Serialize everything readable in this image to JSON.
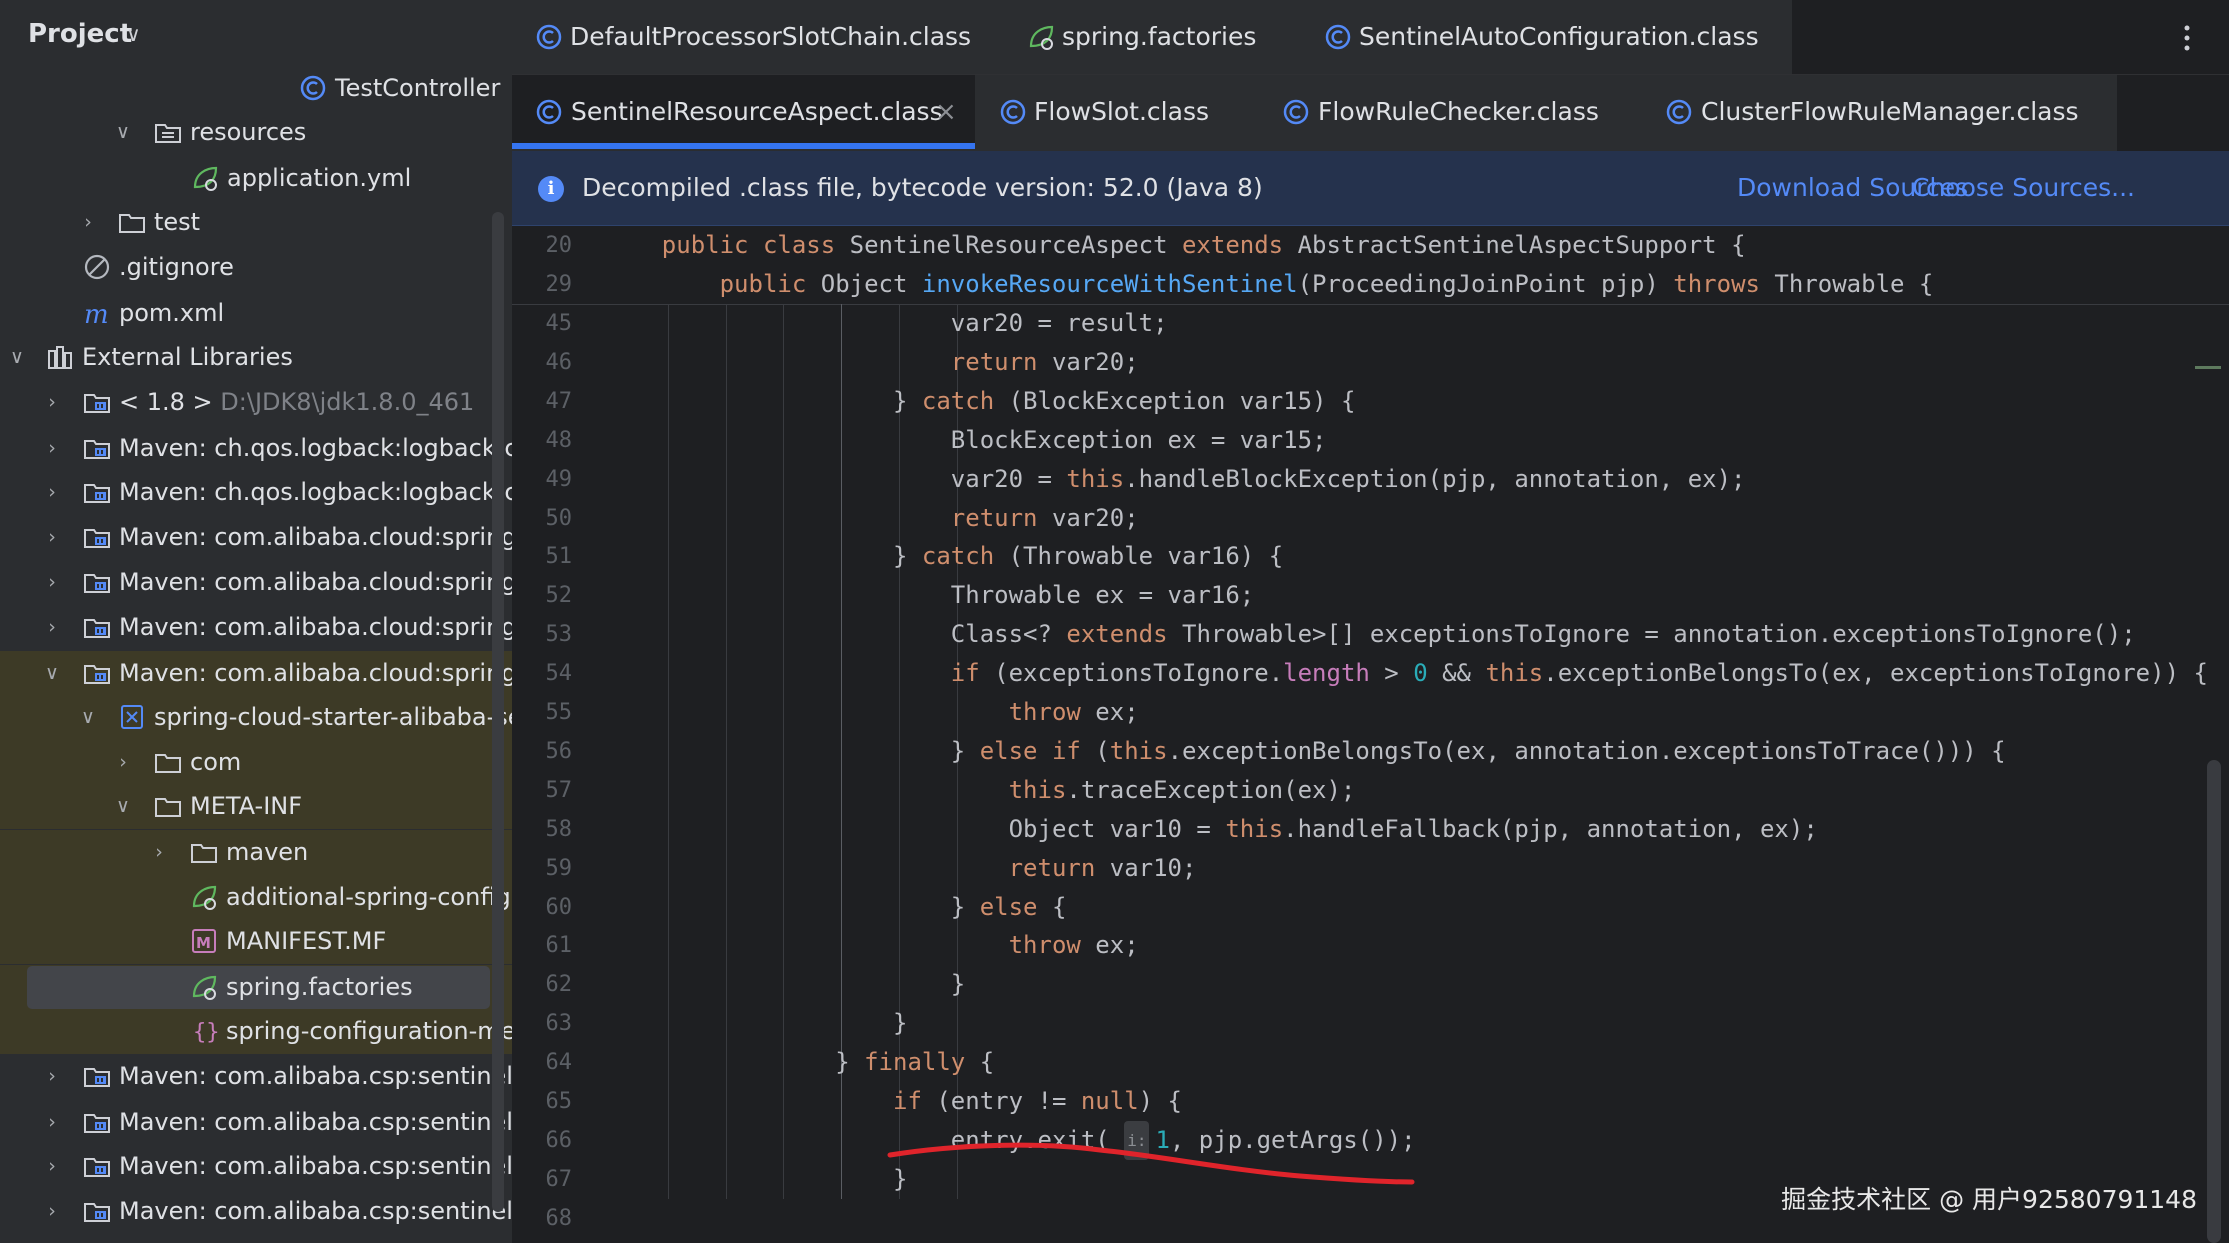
{
  "project": {
    "title": "Project",
    "tree": [
      {
        "label": "TestController",
        "icon": "class-icon",
        "expanded": null
      },
      {
        "label": "resources",
        "icon": "resources-folder-icon",
        "expanded": true
      },
      {
        "label": "application.yml",
        "icon": "spring-config-icon",
        "expanded": null
      },
      {
        "label": "test",
        "icon": "folder-icon",
        "expanded": false
      },
      {
        "label": ".gitignore",
        "icon": "gitignore-icon",
        "expanded": null
      },
      {
        "label": "pom.xml",
        "icon": "maven-icon",
        "expanded": null
      },
      {
        "label": "External Libraries",
        "icon": "libraries-icon",
        "expanded": true
      },
      {
        "label": "< 1.8 >",
        "path": "D:\\JDK8\\jdk1.8.0_461",
        "icon": "jdk-icon",
        "expanded": false
      },
      {
        "label": "Maven: ch.qos.logback:logback-cl",
        "icon": "library-icon",
        "expanded": false
      },
      {
        "label": "Maven: ch.qos.logback:logback-co",
        "icon": "library-icon",
        "expanded": false
      },
      {
        "label": "Maven: com.alibaba.cloud:spring-c",
        "icon": "library-icon",
        "expanded": false
      },
      {
        "label": "Maven: com.alibaba.cloud:spring-c",
        "icon": "library-icon",
        "expanded": false
      },
      {
        "label": "Maven: com.alibaba.cloud:spring-c",
        "icon": "library-icon",
        "expanded": false
      },
      {
        "label": "Maven: com.alibaba.cloud:spring-c",
        "icon": "library-icon",
        "expanded": true
      },
      {
        "label": "spring-cloud-starter-alibaba-se",
        "icon": "jar-icon",
        "expanded": true
      },
      {
        "label": "com",
        "icon": "folder-icon",
        "expanded": false
      },
      {
        "label": "META-INF",
        "icon": "folder-icon",
        "expanded": true
      },
      {
        "label": "maven",
        "icon": "folder-icon",
        "expanded": false
      },
      {
        "label": "additional-spring-configu",
        "icon": "spring-config-icon",
        "expanded": null
      },
      {
        "label": "MANIFEST.MF",
        "icon": "manifest-icon",
        "expanded": null
      },
      {
        "label": "spring.factories",
        "icon": "spring-factories-icon",
        "expanded": null
      },
      {
        "label": "spring-configuration-met",
        "icon": "json-icon",
        "expanded": null
      },
      {
        "label": "Maven: com.alibaba.csp:sentinel-a",
        "icon": "library-icon",
        "expanded": false
      },
      {
        "label": "Maven: com.alibaba.csp:sentinel-c",
        "icon": "library-icon",
        "expanded": false
      },
      {
        "label": "Maven: com.alibaba.csp:sentinel-c",
        "icon": "library-icon",
        "expanded": false
      },
      {
        "label": "Maven: com.alibaba.csp:sentinel-c",
        "icon": "library-icon",
        "expanded": false
      }
    ]
  },
  "tabs": {
    "row1": [
      {
        "label": "DefaultProcessorSlotChain.class",
        "icon": "class-icon"
      },
      {
        "label": "spring.factories",
        "icon": "spring-factories-icon"
      },
      {
        "label": "SentinelAutoConfiguration.class",
        "icon": "class-icon"
      }
    ],
    "row2": [
      {
        "label": "SentinelResourceAspect.class",
        "icon": "class-icon",
        "active": true
      },
      {
        "label": "FlowSlot.class",
        "icon": "class-icon"
      },
      {
        "label": "FlowRuleChecker.class",
        "icon": "class-icon"
      },
      {
        "label": "ClusterFlowRuleManager.class",
        "icon": "class-icon"
      }
    ]
  },
  "banner": {
    "text": "Decompiled .class file, bytecode version: 52.0 (Java 8)",
    "download": "Download Sources",
    "choose": "Choose Sources..."
  },
  "code": {
    "sticky": [
      {
        "num": "20",
        "text": "public class SentinelResourceAspect extends AbstractSentinelAspectSupport {"
      },
      {
        "num": "29",
        "text": "public Object invokeResourceWithSentinel(ProceedingJoinPoint pjp) throws Throwable {"
      }
    ],
    "lines": [
      {
        "num": "45",
        "text": "var20 = result;"
      },
      {
        "num": "46",
        "text": "return var20;"
      },
      {
        "num": "47",
        "text": "} catch (BlockException var15) {"
      },
      {
        "num": "48",
        "text": "BlockException ex = var15;"
      },
      {
        "num": "49",
        "text": "var20 = this.handleBlockException(pjp, annotation, ex);"
      },
      {
        "num": "50",
        "text": "return var20;"
      },
      {
        "num": "51",
        "text": "} catch (Throwable var16) {"
      },
      {
        "num": "52",
        "text": "Throwable ex = var16;"
      },
      {
        "num": "53",
        "text": "Class<? extends Throwable>[] exceptionsToIgnore = annotation.exceptionsToIgnore();"
      },
      {
        "num": "54",
        "text": "if (exceptionsToIgnore.length > 0 && this.exceptionBelongsTo(ex, exceptionsToIgnore)) {"
      },
      {
        "num": "55",
        "text": "throw ex;"
      },
      {
        "num": "56",
        "text": "} else if (this.exceptionBelongsTo(ex, annotation.exceptionsToTrace())) {"
      },
      {
        "num": "57",
        "text": "this.traceException(ex);"
      },
      {
        "num": "58",
        "text": "Object var10 = this.handleFallback(pjp, annotation, ex);"
      },
      {
        "num": "59",
        "text": "return var10;"
      },
      {
        "num": "60",
        "text": "} else {"
      },
      {
        "num": "61",
        "text": "throw ex;"
      },
      {
        "num": "62",
        "text": "}"
      },
      {
        "num": "63",
        "text": "}"
      },
      {
        "num": "64",
        "text": "} finally {"
      },
      {
        "num": "65",
        "text": "if (entry != null) {"
      },
      {
        "num": "66",
        "text": "entry.exit( i: 1, pjp.getArgs());"
      },
      {
        "num": "67",
        "text": "}"
      },
      {
        "num": "68",
        "text": ""
      }
    ],
    "inlay_hint": "i:"
  },
  "watermark": "掘金技术社区 @ 用户92580791148",
  "colors": {
    "keyword": "#cf8e6d",
    "method_decl": "#56a8f5",
    "number": "#2aacb8",
    "field": "#c77dbb",
    "accent": "#3574f0",
    "annotation_stroke": "#e0242b"
  }
}
